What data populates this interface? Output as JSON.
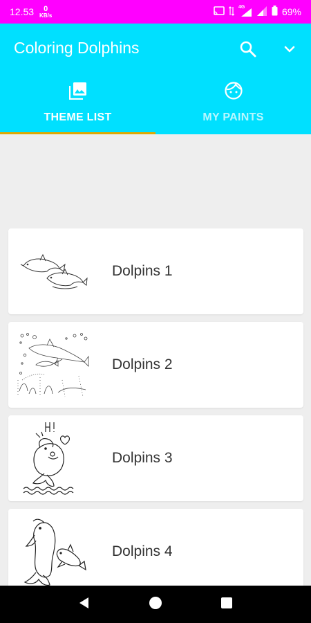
{
  "status_bar": {
    "time": "12.53",
    "net_speed_value": "0",
    "net_speed_unit": "KB/s",
    "network_type": "4G",
    "battery": "69%",
    "background_color": "#ff00ff"
  },
  "app_bar": {
    "title": "Coloring Dolphins",
    "background_color": "#00e0ff",
    "actions": [
      {
        "name": "search",
        "icon": "search-icon"
      },
      {
        "name": "more",
        "icon": "chevron-down-icon"
      }
    ]
  },
  "tabs": [
    {
      "label": "THEME LIST",
      "icon": "photo-library-icon",
      "selected": true
    },
    {
      "label": "MY PAINTS",
      "icon": "face-icon",
      "selected": false
    }
  ],
  "themes": [
    {
      "label": "Dolpins 1",
      "thumbnail": "dolphins-jumping-sketch"
    },
    {
      "label": "Dolpins 2",
      "thumbnail": "dolphins-underwater-sketch"
    },
    {
      "label": "Dolpins 3",
      "thumbnail": "dolphin-saying-hi-sketch"
    },
    {
      "label": "Dolpins 4",
      "thumbnail": "dolphin-mother-and-baby-sketch"
    }
  ],
  "tab_indicator_color": "#e0a800",
  "nav_bar": {
    "buttons": [
      "back-icon",
      "home-icon",
      "recents-icon"
    ]
  }
}
